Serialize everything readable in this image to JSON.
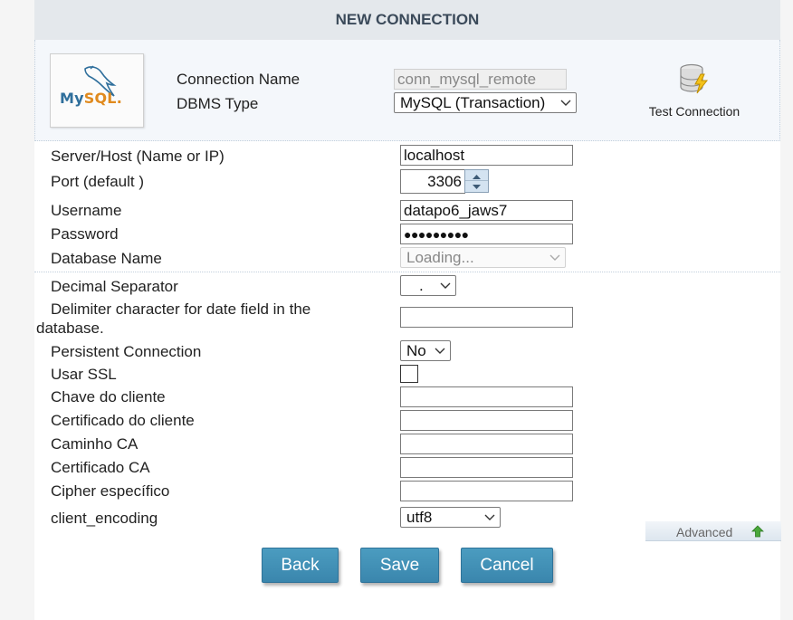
{
  "title": "NEW CONNECTION",
  "logo": {
    "text_part1": "My",
    "text_part2": "SQL",
    "mark": "."
  },
  "header": {
    "connection_name_label": "Connection Name",
    "connection_name_value": "conn_mysql_remote",
    "dbms_type_label": "DBMS Type",
    "dbms_type_value": "MySQL (Transaction)",
    "test_connection_label": "Test Connection",
    "test_connection_icon": "database-lightning-icon"
  },
  "fields": {
    "server_label": "Server/Host (Name or IP)",
    "server_value": "localhost",
    "port_label": "Port (default )",
    "port_value": "3306",
    "username_label": "Username",
    "username_value": "datapo6_jaws7",
    "password_label": "Password",
    "password_value": "●●●●●●●●●",
    "database_label": "Database Name",
    "database_value": "Loading...",
    "decimal_label": "Decimal Separator",
    "decimal_value": ".",
    "delimiter_label_line1": "Delimiter character for date field in the",
    "delimiter_label_line2": "database.",
    "delimiter_value": "",
    "persistent_label": "Persistent Connection",
    "persistent_value": "No",
    "ssl_label": "Usar SSL",
    "ssl_checked": false,
    "client_key_label": "Chave do cliente",
    "client_key_value": "",
    "client_cert_label": "Certificado do cliente",
    "client_cert_value": "",
    "ca_path_label": "Caminho CA",
    "ca_path_value": "",
    "ca_cert_label": "Certificado CA",
    "ca_cert_value": "",
    "cipher_label": "Cipher específico",
    "cipher_value": "",
    "encoding_label": "client_encoding",
    "encoding_value": "utf8"
  },
  "advanced_label": "Advanced",
  "buttons": {
    "back": "Back",
    "save": "Save",
    "cancel": "Cancel"
  },
  "colors": {
    "button": "#3f8fb6",
    "title_bar": "#e4e8ec",
    "title_text": "#3b4a5a"
  }
}
